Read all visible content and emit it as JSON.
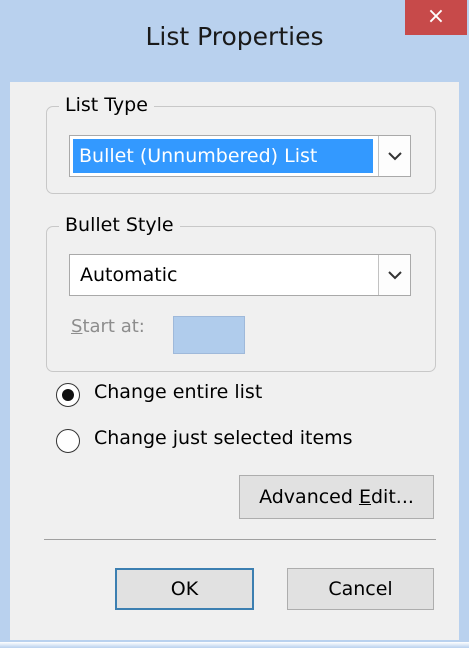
{
  "window": {
    "title": "List Properties",
    "close_glyph": "×",
    "title_bar_color": "#b9d1ee",
    "close_color": "#c74a4a"
  },
  "list_type": {
    "group_label": "List Type",
    "selected": "Bullet (Unnumbered) List"
  },
  "bullet_style": {
    "group_label": "Bullet Style",
    "selected": "Automatic",
    "start_at": {
      "label_prefix": "S",
      "label_rest": "tart at:",
      "value": ""
    }
  },
  "scope": {
    "options": [
      {
        "label": "Change entire list",
        "checked": true
      },
      {
        "label": "Change just selected items",
        "checked": false
      }
    ]
  },
  "buttons": {
    "advanced_prefix": "Advanced ",
    "advanced_mnemonic": "E",
    "advanced_suffix": "dit...",
    "ok": "OK",
    "cancel": "Cancel"
  },
  "colors": {
    "selection": "#3399ff",
    "default_button_border": "#3c7fb1"
  }
}
